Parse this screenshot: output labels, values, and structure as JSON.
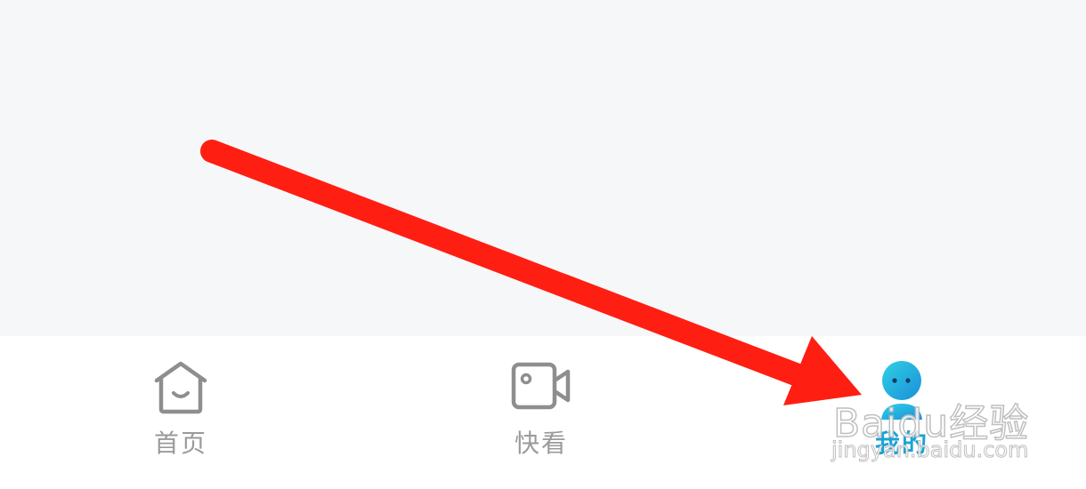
{
  "tabs": [
    {
      "id": "home",
      "label": "首页",
      "icon": "home-icon",
      "active": false
    },
    {
      "id": "watch",
      "label": "快看",
      "icon": "video-camera-icon",
      "active": false
    },
    {
      "id": "mine",
      "label": "我的",
      "icon": "avatar-icon",
      "active": true
    }
  ],
  "colors": {
    "background": "#f6f7f9",
    "tab_bar": "#ffffff",
    "inactive": "#9a9a9a",
    "active": "#1aa3d6",
    "arrow": "#ff1e12"
  },
  "watermark": {
    "logo": "Baidu经验",
    "url": "jingyan.baidu.com"
  }
}
